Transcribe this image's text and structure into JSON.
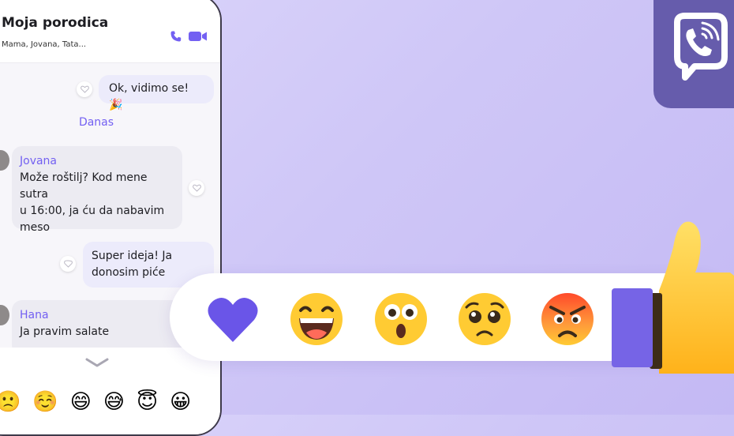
{
  "chat": {
    "title": "Moja porodica",
    "members": "Mama, Jovana, Tata...",
    "messages": [
      {
        "type": "outgoing",
        "text": "Ok, vidimo se! 🎉"
      },
      {
        "type": "date",
        "text": "Danas"
      },
      {
        "type": "incoming",
        "sender": "Jovana",
        "lines": [
          "Može roštilj? Kod mene sutra",
          "u 16:00, ja ću da nabavim",
          "meso"
        ]
      },
      {
        "type": "outgoing",
        "lines": [
          "Super ideja! Ja",
          "donosim piće"
        ]
      },
      {
        "type": "incoming",
        "sender": "Hana",
        "lines": [
          "Ja pravim salate"
        ]
      }
    ]
  },
  "keyboard": {
    "emojis": [
      "🙁",
      "☺️",
      "😄",
      "😅",
      "😇",
      "😀"
    ]
  },
  "reactions": [
    "purple-heart",
    "laughing-face",
    "surprised-face",
    "pleading-face",
    "angry-face"
  ],
  "colors": {
    "accent": "#7360f2",
    "logo_bg": "#665cac",
    "background": "#cfc7f7"
  }
}
